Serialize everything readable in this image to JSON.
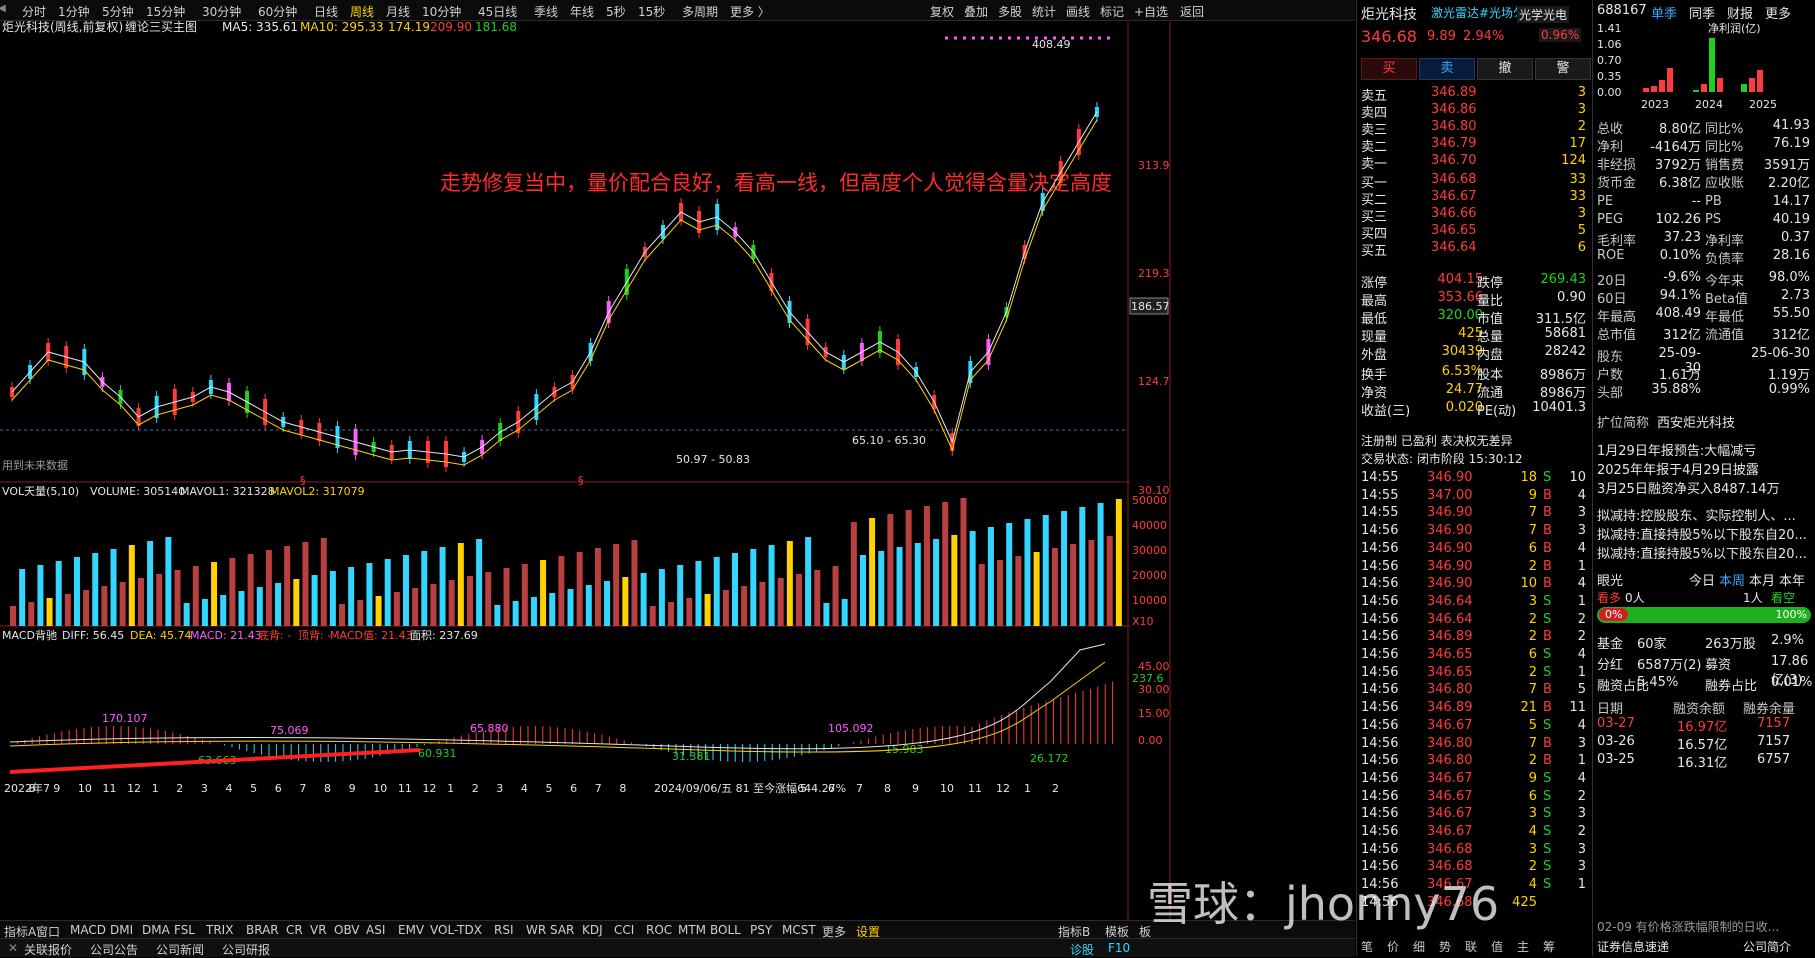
{
  "toolbar": {
    "periods": [
      "分时",
      "1分钟",
      "5分钟",
      "15分钟",
      "30分钟",
      "60分钟",
      "日线",
      "周线",
      "月线",
      "10分钟",
      "45日线",
      "季线",
      "年线",
      "5秒",
      "15秒",
      "多周期",
      "更多"
    ],
    "active_period": "周线",
    "right": [
      "复权",
      "叠加",
      "多股",
      "统计",
      "画线",
      "标记",
      "+自选",
      "返回"
    ]
  },
  "chart_header": {
    "title": "炬光科技(周线,前复权)",
    "indicator": "缠论三买主图",
    "ma5": "MA5: 335.61",
    "ma10": "MA10: 295.33",
    "v1": "174.19",
    "v2": "209.90",
    "v3": "181.68"
  },
  "annotation": "走势修复当中，量价配合良好，看高一线，但高度个人觉得含量决定高度",
  "price_axis": [
    "313.9",
    "219.3",
    "186.57",
    "124.7",
    "30.10"
  ],
  "price_labels": {
    "high": "408.49",
    "range1": "65.10 - 65.30",
    "range2": "50.97 - 50.83",
    "future": "用到未来数据",
    "s_marks": [
      "§",
      "§"
    ]
  },
  "vol_header": {
    "name": "VOL天量(5,10)",
    "volume": "VOLUME: 305140",
    "mavol1": "MAVOL1: 321328",
    "mavol2": "MAVOL2: 317079"
  },
  "vol_axis": [
    "50000",
    "40000",
    "30000",
    "20000",
    "10000",
    "X10"
  ],
  "macd_header": {
    "name": "MACD背驰",
    "diff": "DIFF: 56.45",
    "dea": "DEA: 45.74",
    "macd": "MACD: 21.43",
    "bottom": "底背: -",
    "top": "顶背: -",
    "macdval": "MACD值: 21.43",
    "area": "面积: 237.69"
  },
  "macd_axis": [
    "45.00",
    "30.00",
    "15.00",
    "0.00"
  ],
  "macd_labels": [
    "170.107",
    "75.069",
    "65.880",
    "105.092",
    "63.663",
    "60.931",
    "31.381",
    "15.983",
    "26.172",
    "237.6"
  ],
  "xaxis": [
    "2022年7",
    "8",
    "9",
    "10",
    "11",
    "12",
    "1",
    "2",
    "3",
    "4",
    "5",
    "6",
    "7",
    "8",
    "9",
    "10",
    "11",
    "12",
    "1",
    "2",
    "3",
    "4",
    "5",
    "6",
    "7",
    "8",
    "2024/09/06/五 81 至今涨幅644.27%",
    "5",
    "6",
    "7",
    "8",
    "9",
    "10",
    "11",
    "12",
    "1",
    "2"
  ],
  "bottom_tabs": [
    "指标A",
    "窗口",
    "MACD",
    "DMI",
    "DMA",
    "FSL",
    "TRIX",
    "BRAR",
    "CR",
    "VR",
    "OBV",
    "ASI",
    "EMV",
    "VOL-TDX",
    "RSI",
    "WR",
    "SAR",
    "KDJ",
    "CCI",
    "ROC",
    "MTM",
    "BOLL",
    "PSY",
    "MCST",
    "更多",
    "设置"
  ],
  "bottom_right": [
    "指标B",
    "模板",
    "板"
  ],
  "status": [
    "关联报价",
    "公司公告",
    "公司新闻",
    "公司研报"
  ],
  "status_right": [
    "诊股",
    "F10"
  ],
  "quote": {
    "name": "炬光科技",
    "tag": "激光雷达#光场匀化",
    "sub": "光学光电",
    "sub_pct": "0.96%",
    "price": "346.68",
    "change": "9.89",
    "pct": "2.94%",
    "buy": "买",
    "sell": "卖",
    "cancel": "撤",
    "alert": "警",
    "asks": [
      [
        "卖五",
        "346.89",
        "3"
      ],
      [
        "卖四",
        "346.86",
        "3"
      ],
      [
        "卖三",
        "346.80",
        "2"
      ],
      [
        "卖二",
        "346.79",
        "17"
      ],
      [
        "卖一",
        "346.70",
        "124"
      ]
    ],
    "bids": [
      [
        "买一",
        "346.68",
        "33"
      ],
      [
        "买二",
        "346.67",
        "33"
      ],
      [
        "买三",
        "346.66",
        "3"
      ],
      [
        "买四",
        "346.65",
        "5"
      ],
      [
        "买五",
        "346.64",
        "6"
      ]
    ],
    "stats": [
      [
        "涨停",
        "404.15",
        "跌停",
        "269.43"
      ],
      [
        "最高",
        "353.66",
        "量比",
        "0.90"
      ],
      [
        "最低",
        "320.00",
        "市值",
        "311.5亿"
      ],
      [
        "现量",
        "425",
        "总量",
        "58681"
      ],
      [
        "外盘",
        "30439",
        "内盘",
        "28242"
      ],
      [
        "换手",
        "6.53%",
        "股本",
        "8986万"
      ],
      [
        "净资",
        "24.77",
        "流通",
        "8986万"
      ],
      [
        "收益(三)",
        "0.020",
        "PE(动)",
        "10401.3"
      ]
    ],
    "tags": "注册制 已盈利 表决权无差异",
    "trade_status": "交易状态: 闭市阶段 15:30:12",
    "ticks": [
      [
        "14:55",
        "346.90",
        "18",
        "S",
        "10"
      ],
      [
        "14:55",
        "347.00",
        "9",
        "B",
        "4"
      ],
      [
        "14:55",
        "346.90",
        "7",
        "B",
        "3"
      ],
      [
        "14:56",
        "346.90",
        "7",
        "B",
        "3"
      ],
      [
        "14:56",
        "346.90",
        "6",
        "B",
        "4"
      ],
      [
        "14:56",
        "346.90",
        "2",
        "B",
        "1"
      ],
      [
        "14:56",
        "346.90",
        "10",
        "B",
        "4"
      ],
      [
        "14:56",
        "346.64",
        "3",
        "S",
        "1"
      ],
      [
        "14:56",
        "346.64",
        "2",
        "S",
        "2"
      ],
      [
        "14:56",
        "346.89",
        "2",
        "B",
        "2"
      ],
      [
        "14:56",
        "346.65",
        "6",
        "S",
        "4"
      ],
      [
        "14:56",
        "346.65",
        "2",
        "S",
        "1"
      ],
      [
        "14:56",
        "346.80",
        "7",
        "B",
        "5"
      ],
      [
        "14:56",
        "346.89",
        "21",
        "B",
        "11"
      ],
      [
        "14:56",
        "346.67",
        "5",
        "S",
        "4"
      ],
      [
        "14:56",
        "346.80",
        "7",
        "B",
        "3"
      ],
      [
        "14:56",
        "346.80",
        "2",
        "B",
        "1"
      ],
      [
        "14:56",
        "346.67",
        "9",
        "S",
        "4"
      ],
      [
        "14:56",
        "346.67",
        "6",
        "S",
        "2"
      ],
      [
        "14:56",
        "346.67",
        "3",
        "S",
        "3"
      ],
      [
        "14:56",
        "346.67",
        "4",
        "S",
        "2"
      ],
      [
        "14:56",
        "346.68",
        "3",
        "S",
        "3"
      ],
      [
        "14:56",
        "346.68",
        "2",
        "S",
        "3"
      ],
      [
        "14:56",
        "346.67",
        "4",
        "S",
        "1"
      ],
      [
        "14:56",
        "346.68",
        "425",
        "",
        ""
      ]
    ],
    "watermark": "雪球：jhonny76",
    "footer": [
      "笔",
      "价",
      "细",
      "势",
      "联",
      "值",
      "主",
      "筹"
    ]
  },
  "fin": {
    "code": "688167",
    "tabs": [
      "单季",
      "同季",
      "财报",
      "更多"
    ],
    "chart_label": "净利润(亿)",
    "chart_y": [
      "1.41",
      "1.06",
      "0.70",
      "0.35",
      "0.00"
    ],
    "chart_years": [
      "2023",
      "2024",
      "2025"
    ],
    "rows": [
      [
        "总收",
        "8.80亿",
        "同比%",
        "41.93"
      ],
      [
        "净利",
        "-4164万",
        "同比%",
        "76.19"
      ],
      [
        "非经损",
        "3792万",
        "销售费",
        "3591万"
      ],
      [
        "货币金",
        "6.38亿",
        "应收账",
        "2.20亿"
      ],
      [
        "PE",
        "--",
        "PB",
        "14.17"
      ],
      [
        "PEG",
        "102.26",
        "PS",
        "40.19"
      ],
      [
        "毛利率",
        "37.23",
        "净利率",
        "0.37"
      ],
      [
        "ROE",
        "0.10%",
        "负债率",
        "28.16"
      ],
      [
        "20日",
        "-9.6%",
        "今年来",
        "98.0%"
      ],
      [
        "60日",
        "94.1%",
        "Beta值",
        "2.73"
      ],
      [
        "年最高",
        "408.49",
        "年最低",
        "55.50"
      ],
      [
        "总市值",
        "312亿",
        "流通值",
        "312亿"
      ],
      [
        "股东",
        "25-09-30",
        "",
        "25-06-30"
      ],
      [
        "户数",
        "1.61万",
        "",
        "1.19万"
      ],
      [
        "头部",
        "35.88%",
        "",
        "0.99%"
      ]
    ],
    "abbr_label": "扩位简称",
    "abbr": "西安炬光科技",
    "news": [
      "1月29日年报预告:大幅减亏",
      "2025年年报于4月29日披露",
      "3月25日融资净买入8487.14万"
    ],
    "notices": [
      "拟减持:控股股东、实际控制人、...",
      "拟减持:直接持股5%以下股东自20...",
      "拟减持:直接持股5%以下股东自20..."
    ],
    "eye": {
      "label": "眼光",
      "tabs": [
        "今日",
        "本周",
        "本月",
        "本年"
      ],
      "bear": "看多",
      "bear_count": "0人",
      "bull_count": "1人",
      "bull": "看空",
      "pct_left": "0%",
      "pct_right": "100%"
    },
    "fund": [
      "基金",
      "60家",
      "263万股",
      "2.9%"
    ],
    "fenhong": [
      "分红",
      "6587万(2)",
      "募资",
      "17.86亿(3)"
    ],
    "margin_ratio": [
      "融资占比",
      "5.45%",
      "融券占比",
      "0.01%"
    ],
    "margin_head": [
      "日期",
      "融资余额",
      "融券余量"
    ],
    "margin_rows": [
      [
        "03-27",
        "16.97亿",
        "7157"
      ],
      [
        "03-26",
        "16.57亿",
        "7157"
      ],
      [
        "03-25",
        "16.31亿",
        "6757"
      ]
    ],
    "bottom_news": "02-09 有价格涨跌幅限制的日收...",
    "footer": "证券信息速递",
    "footer2": "公司简介"
  }
}
